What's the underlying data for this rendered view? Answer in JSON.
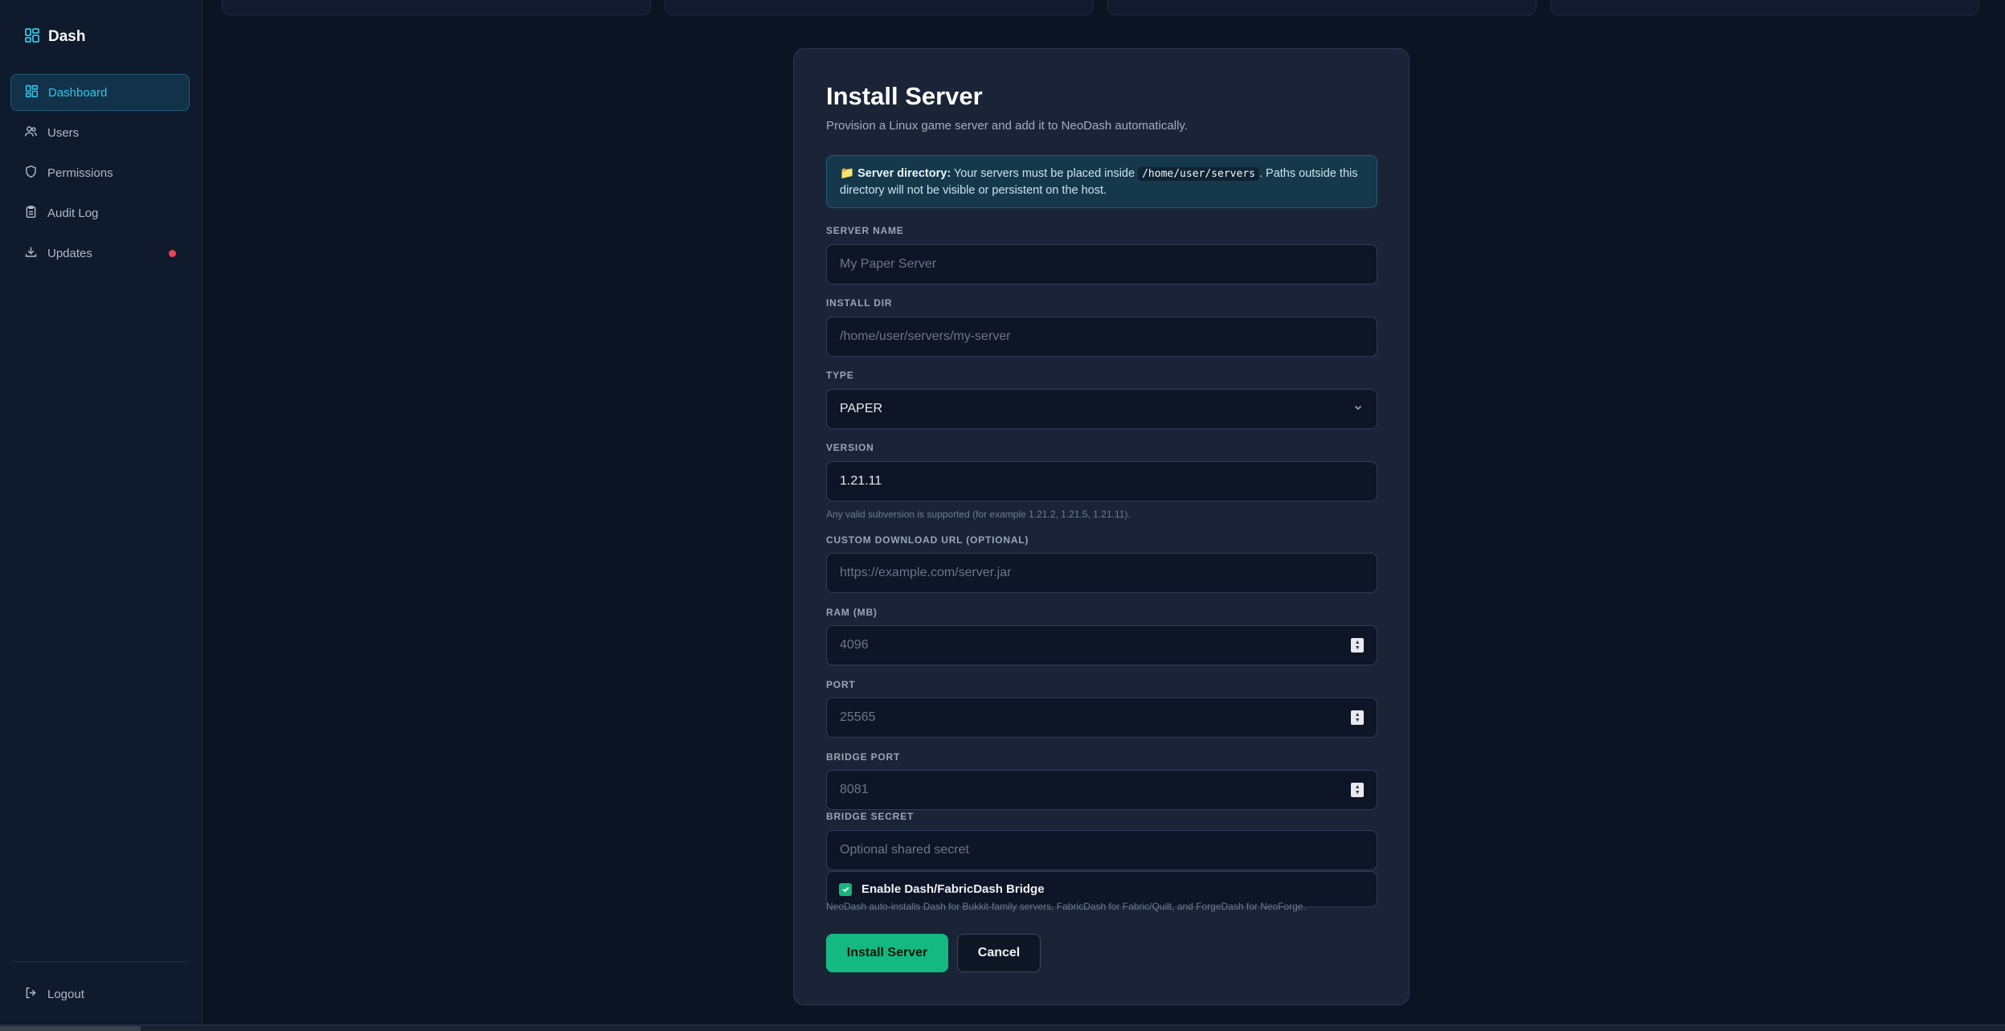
{
  "brand": {
    "name": "Dash",
    "icon": "dashboard-grid-icon",
    "accent": "#2ec7e6"
  },
  "sidebar": {
    "items": [
      {
        "label": "Dashboard",
        "icon": "dashboard-grid-icon",
        "active": true
      },
      {
        "label": "Users",
        "icon": "users-icon",
        "active": false
      },
      {
        "label": "Permissions",
        "icon": "shield-icon",
        "active": false
      },
      {
        "label": "Audit Log",
        "icon": "clipboard-icon",
        "active": false
      },
      {
        "label": "Updates",
        "icon": "download-icon",
        "active": false,
        "badge_color": "#f0445a"
      }
    ],
    "logout": {
      "label": "Logout",
      "icon": "logout-icon"
    }
  },
  "form": {
    "title": "Install Server",
    "subtitle": "Provision a Linux game server and add it to NeoDash automatically.",
    "notice": {
      "icon": "folder-icon",
      "emoji": "📁",
      "bold": "Server directory:",
      "text_before": " Your servers must be placed inside ",
      "code": "/home/user/servers",
      "text_after": ". Paths outside this directory will not be visible or persistent on the host."
    },
    "fields": {
      "server_name": {
        "label": "SERVER NAME",
        "value": "",
        "placeholder": "My Paper Server"
      },
      "install_dir": {
        "label": "INSTALL DIR",
        "value": "",
        "placeholder": "/home/user/servers/my-server"
      },
      "type": {
        "label": "TYPE",
        "value": "PAPER"
      },
      "version": {
        "label": "VERSION",
        "value": "1.21.11",
        "hint": "Any valid subversion is supported (for example 1.21.2, 1.21.5, 1.21.11)."
      },
      "download_url": {
        "label": "CUSTOM DOWNLOAD URL (OPTIONAL)",
        "value": "",
        "placeholder": "https://example.com/server.jar"
      },
      "ram": {
        "label": "RAM (MB)",
        "value": "",
        "placeholder": "4096"
      },
      "port": {
        "label": "PORT",
        "value": "",
        "placeholder": "25565"
      },
      "bridge_port": {
        "label": "BRIDGE PORT",
        "value": "",
        "placeholder": "8081"
      },
      "bridge_secret": {
        "label": "BRIDGE SECRET",
        "value": "",
        "placeholder": "Optional shared secret"
      }
    },
    "bridge_checkbox": {
      "label": "Enable Dash/FabricDash Bridge",
      "checked": true,
      "hint": "NeoDash auto-installs Dash for Bukkit-family servers, FabricDash for Fabric/Quilt, and ForgeDash for NeoForge."
    },
    "buttons": {
      "submit": "Install Server",
      "cancel": "Cancel"
    },
    "colors": {
      "primary": "#14b981",
      "notice_bg": "#15384b"
    }
  }
}
